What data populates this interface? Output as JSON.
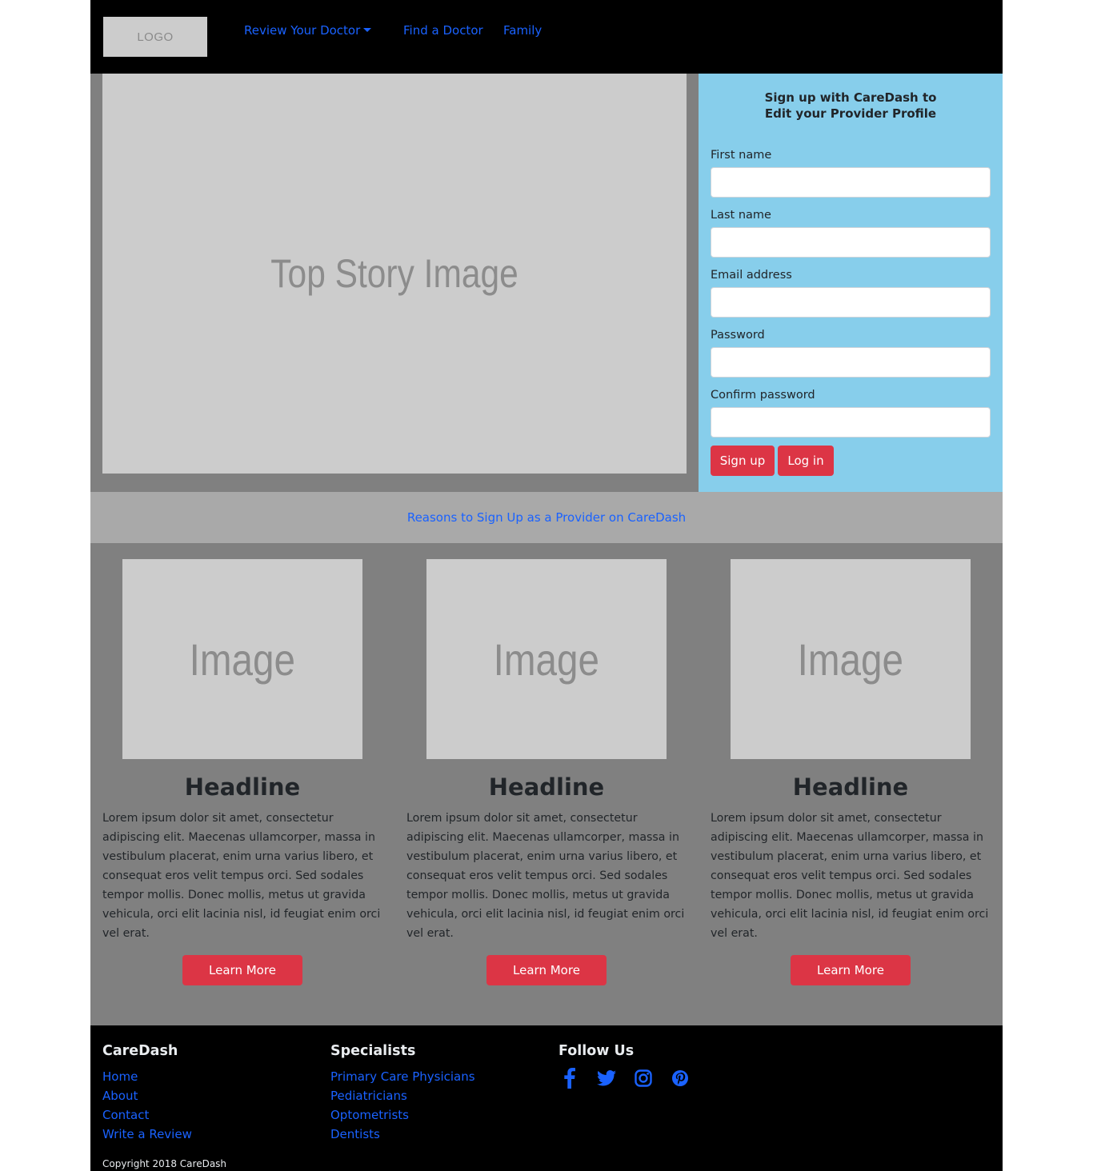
{
  "nav": {
    "logo": "LOGO",
    "links": [
      {
        "label": "Review Your Doctor"
      },
      {
        "label": "Find a Doctor"
      },
      {
        "label": "Family"
      }
    ]
  },
  "hero": {
    "image_label": "Top Story Image",
    "signup": {
      "title_line1": "Sign up with CareDash to",
      "title_line2": "Edit your Provider Profile",
      "fields": [
        {
          "label": "First name",
          "value": ""
        },
        {
          "label": "Last name",
          "value": ""
        },
        {
          "label": "Email address",
          "value": ""
        },
        {
          "label": "Password",
          "value": ""
        },
        {
          "label": "Confirm password",
          "value": ""
        }
      ],
      "signup_button": "Sign up",
      "login_button": "Log in"
    }
  },
  "banner": {
    "link": "Reasons to Sign Up as a Provider on CareDash"
  },
  "cards": [
    {
      "image_label": "Image",
      "headline": "Headline",
      "text": "Lorem ipsum dolor sit amet, consectetur adipiscing elit. Maecenas ullamcorper, massa in vestibulum placerat, enim urna varius libero, et consequat eros velit tempus orci. Sed sodales tempor mollis. Donec mollis, metus ut gravida vehicula, orci elit lacinia nisl, id feugiat enim orci vel erat.",
      "button": "Learn More"
    },
    {
      "image_label": "Image",
      "headline": "Headline",
      "text": "Lorem ipsum dolor sit amet, consectetur adipiscing elit. Maecenas ullamcorper, massa in vestibulum placerat, enim urna varius libero, et consequat eros velit tempus orci. Sed sodales tempor mollis. Donec mollis, metus ut gravida vehicula, orci elit lacinia nisl, id feugiat enim orci vel erat.",
      "button": "Learn More"
    },
    {
      "image_label": "Image",
      "headline": "Headline",
      "text": "Lorem ipsum dolor sit amet, consectetur adipiscing elit. Maecenas ullamcorper, massa in vestibulum placerat, enim urna varius libero, et consequat eros velit tempus orci. Sed sodales tempor mollis. Donec mollis, metus ut gravida vehicula, orci elit lacinia nisl, id feugiat enim orci vel erat.",
      "button": "Learn More"
    }
  ],
  "footer": {
    "col1": {
      "title": "CareDash",
      "links": [
        "Home",
        "About",
        "Contact",
        "Write a Review"
      ]
    },
    "col2": {
      "title": "Specialists",
      "links": [
        "Primary Care Physicians",
        "Pediatricians",
        "Optometrists",
        "Dentists"
      ]
    },
    "col3": {
      "title": "Follow Us",
      "icons": [
        "facebook-icon",
        "twitter-icon",
        "instagram-icon",
        "pinterest-icon"
      ]
    },
    "copyright": "Copyright 2018 CareDash"
  },
  "colors": {
    "nav_bg": "#000000",
    "link": "#1a62ff",
    "signup_bg": "#87ceeb",
    "section_bg": "#808080",
    "banner_bg": "#a9a9a9",
    "placeholder": "#cccccc",
    "button": "#dc3545"
  }
}
